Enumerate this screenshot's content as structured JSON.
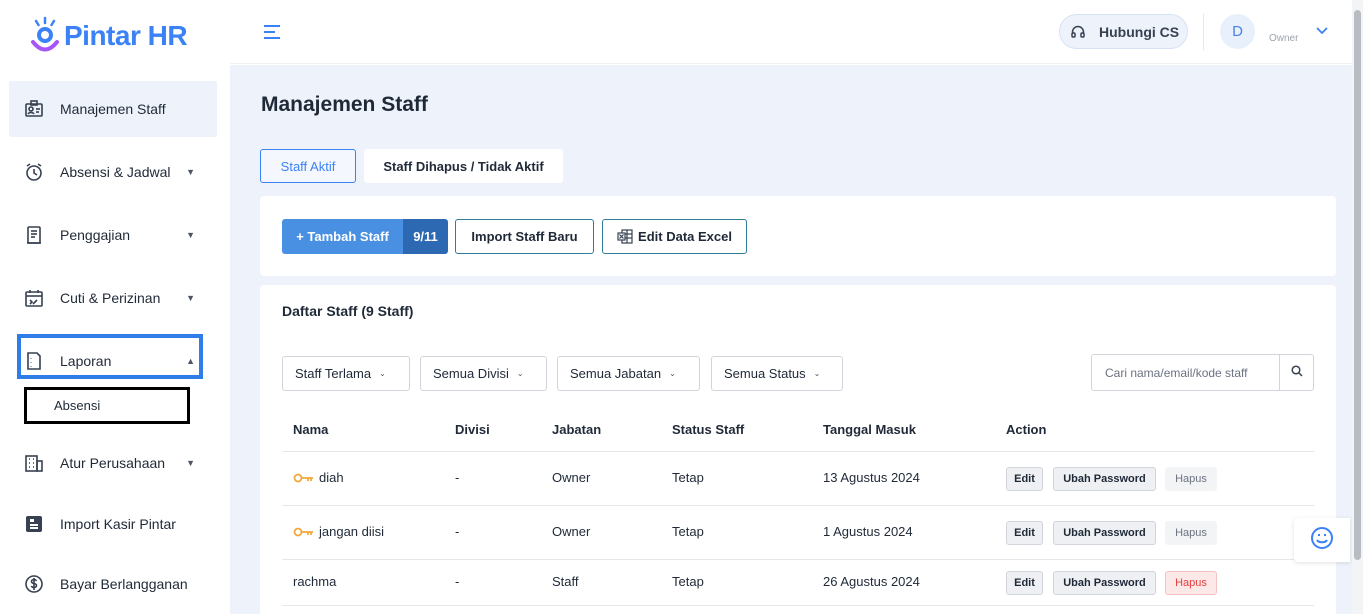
{
  "app": {
    "logo_text": "Pintar HR"
  },
  "sidebar": {
    "items": [
      {
        "label": "Manajemen Staff",
        "icon": "staff-id-icon"
      },
      {
        "label": "Absensi & Jadwal",
        "icon": "alarm-clock-icon"
      },
      {
        "label": "Penggajian",
        "icon": "payroll-receipt-icon"
      },
      {
        "label": "Cuti & Perizinan",
        "icon": "calendar-icon"
      },
      {
        "label": "Laporan",
        "icon": "report-icon"
      },
      {
        "label": "Atur Perusahaan",
        "icon": "building-icon"
      },
      {
        "label": "Import Kasir Pintar",
        "icon": "import-icon"
      },
      {
        "label": "Bayar Berlangganan",
        "icon": "dollar-icon"
      }
    ],
    "submenu": {
      "label": "Absensi"
    }
  },
  "header": {
    "support_label": "Hubungi CS",
    "avatar_initial": "D",
    "role_label": "Owner"
  },
  "page": {
    "title": "Manajemen Staff",
    "tabs": [
      {
        "label": "Staff Aktif",
        "active": true
      },
      {
        "label": "Staff Dihapus / Tidak Aktif",
        "active": false
      }
    ]
  },
  "actions": {
    "add_label": "+ Tambah Staff",
    "add_count": "9/11",
    "import_label": "Import Staff Baru",
    "excel_label": "Edit Data Excel"
  },
  "list": {
    "title": "Daftar Staff (9 Staff)",
    "filters": [
      "Staff Terlama",
      "Semua Divisi",
      "Semua Jabatan",
      "Semua Status"
    ],
    "search_placeholder": "Cari nama/email/kode staff",
    "columns": [
      "Nama",
      "Divisi",
      "Jabatan",
      "Status Staff",
      "Tanggal Masuk",
      "Action"
    ],
    "rows": [
      {
        "nama": "diah",
        "owner_key": true,
        "divisi": "-",
        "jabatan": "Owner",
        "status": "Tetap",
        "tanggal": "13 Agustus 2024",
        "delete_enabled": false
      },
      {
        "nama": "jangan diisi",
        "owner_key": true,
        "divisi": "-",
        "jabatan": "Owner",
        "status": "Tetap",
        "tanggal": "1 Agustus 2024",
        "delete_enabled": false
      },
      {
        "nama": "rachma",
        "owner_key": false,
        "divisi": "-",
        "jabatan": "Staff",
        "status": "Tetap",
        "tanggal": "26 Agustus 2024",
        "delete_enabled": true
      }
    ],
    "row_actions": {
      "edit": "Edit",
      "password": "Ubah Password",
      "delete": "Hapus"
    }
  },
  "colors": {
    "accent": "#3b82f6",
    "accent_dark": "#2d69b3",
    "danger": "#e53e3e",
    "background": "#eef3fb"
  }
}
